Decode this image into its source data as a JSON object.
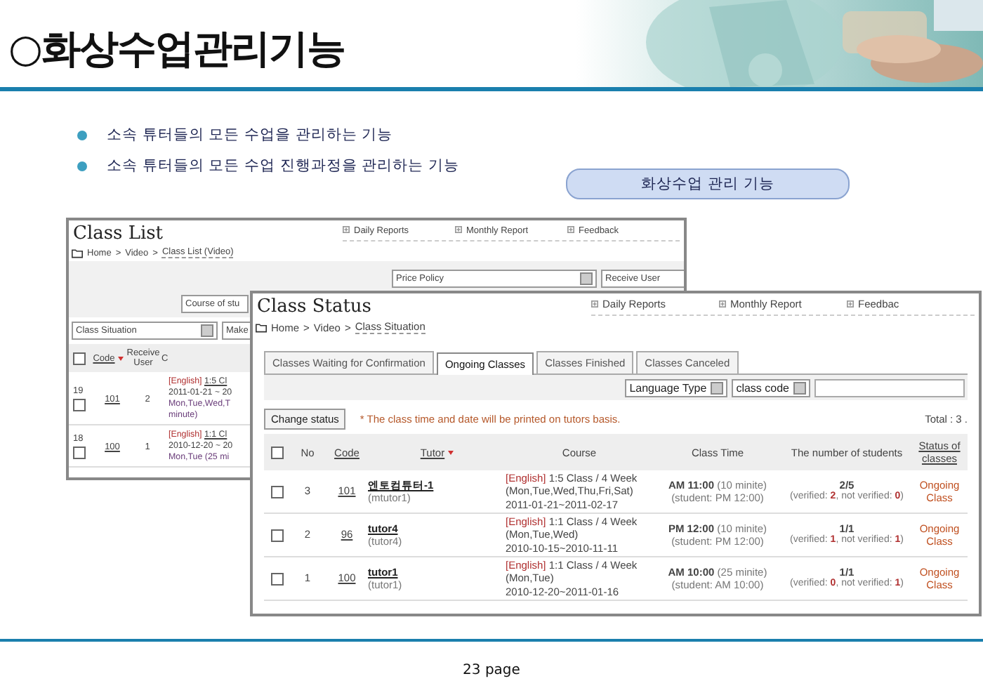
{
  "slide": {
    "title": "○화상수업관리기능",
    "bullets": [
      "소속 튜터들의 모든 수업을 관리하는 기능",
      "소속 튜터들의 모든 수업 진행과정을 관리하는 기능"
    ],
    "badge": "화상수업 관리 기능",
    "page": "23 page"
  },
  "class_list": {
    "title": "Class List",
    "links": [
      "Daily Reports",
      "Monthly Report",
      "Feedback"
    ],
    "breadcrumb": [
      "Home",
      "Video",
      "Class List (Video)"
    ],
    "separator": ">",
    "price_select": "Price Policy",
    "receive_select": "Receive User",
    "course_field": "Course of stu",
    "situation_select": "Class Situation",
    "make_button": "Make",
    "all_checked": false,
    "columns": [
      "Code",
      "Receive User",
      "C"
    ],
    "rows": [
      {
        "id": "19",
        "checked": false,
        "code": "101",
        "receive": "2",
        "lang": "[English]",
        "course": "1:5 Cl",
        "lines": [
          "2011-01-21 ~ 20",
          "Mon,Tue,Wed,T",
          "minute)"
        ]
      },
      {
        "id": "18",
        "checked": false,
        "code": "100",
        "receive": "1",
        "lang": "[English]",
        "course": "1:1 Cl",
        "lines": [
          "2010-12-20 ~ 20",
          "Mon,Tue (25 mi"
        ]
      }
    ]
  },
  "class_status": {
    "title": "Class Status",
    "links": [
      "Daily Reports",
      "Monthly Report",
      "Feedbac"
    ],
    "breadcrumb": [
      "Home",
      "Video",
      "Class Situation"
    ],
    "separator": ">",
    "tabs": [
      {
        "label": "Classes Waiting for Confirmation",
        "selected": false
      },
      {
        "label": "Ongoing Classes",
        "selected": true
      },
      {
        "label": "Classes Finished",
        "selected": false
      },
      {
        "label": "Classes Canceled",
        "selected": false
      }
    ],
    "filters": [
      "Language Type",
      "class code"
    ],
    "all_checked": false,
    "change_button": "Change status",
    "note": "* The class time and date will be printed on tutors basis.",
    "total": "Total : 3 .",
    "columns": [
      "No",
      "Code",
      "Tutor",
      "Course",
      "Class Time",
      "The number of students",
      "Status of classes"
    ],
    "rows": [
      {
        "no": "3",
        "checked": false,
        "code": "101",
        "tutor": "엔토컴튜터-1",
        "tutor_id": "(mtutor1)",
        "lang": "[English]",
        "course": "1:5 Class / 4 Week",
        "days": "(Mon,Tue,Wed,Thu,Fri,Sat)",
        "dates": "2011-01-21~2011-02-17",
        "time": "AM 11:00",
        "duration": "(10 minite)",
        "student_time": "(student: PM 12:00)",
        "count": "2/5",
        "verified": "(verified: **2**, not verified: **0**)",
        "status": "Ongoing Class"
      },
      {
        "no": "2",
        "checked": false,
        "code": "96",
        "tutor": "tutor4",
        "tutor_id": "(tutor4)",
        "lang": "[English]",
        "course": "1:1 Class / 4 Week",
        "days": "(Mon,Tue,Wed)",
        "dates": "2010-10-15~2010-11-11",
        "time": "PM 12:00",
        "duration": "(10 minite)",
        "student_time": "(student: PM 12:00)",
        "count": "1/1",
        "verified": "(verified: **1**, not verified: **1**)",
        "status": "Ongoing Class"
      },
      {
        "no": "1",
        "checked": false,
        "code": "100",
        "tutor": "tutor1",
        "tutor_id": "(tutor1)",
        "lang": "[English]",
        "course": "1:1 Class / 4 Week",
        "days": "(Mon,Tue)",
        "dates": "2010-12-20~2011-01-16",
        "time": "AM 10:00",
        "duration": "(25 minite)",
        "student_time": "(student: AM 10:00)",
        "count": "1/1",
        "verified": "(verified: **0**, not verified: **1**)",
        "status": "Ongoing Class"
      }
    ]
  }
}
